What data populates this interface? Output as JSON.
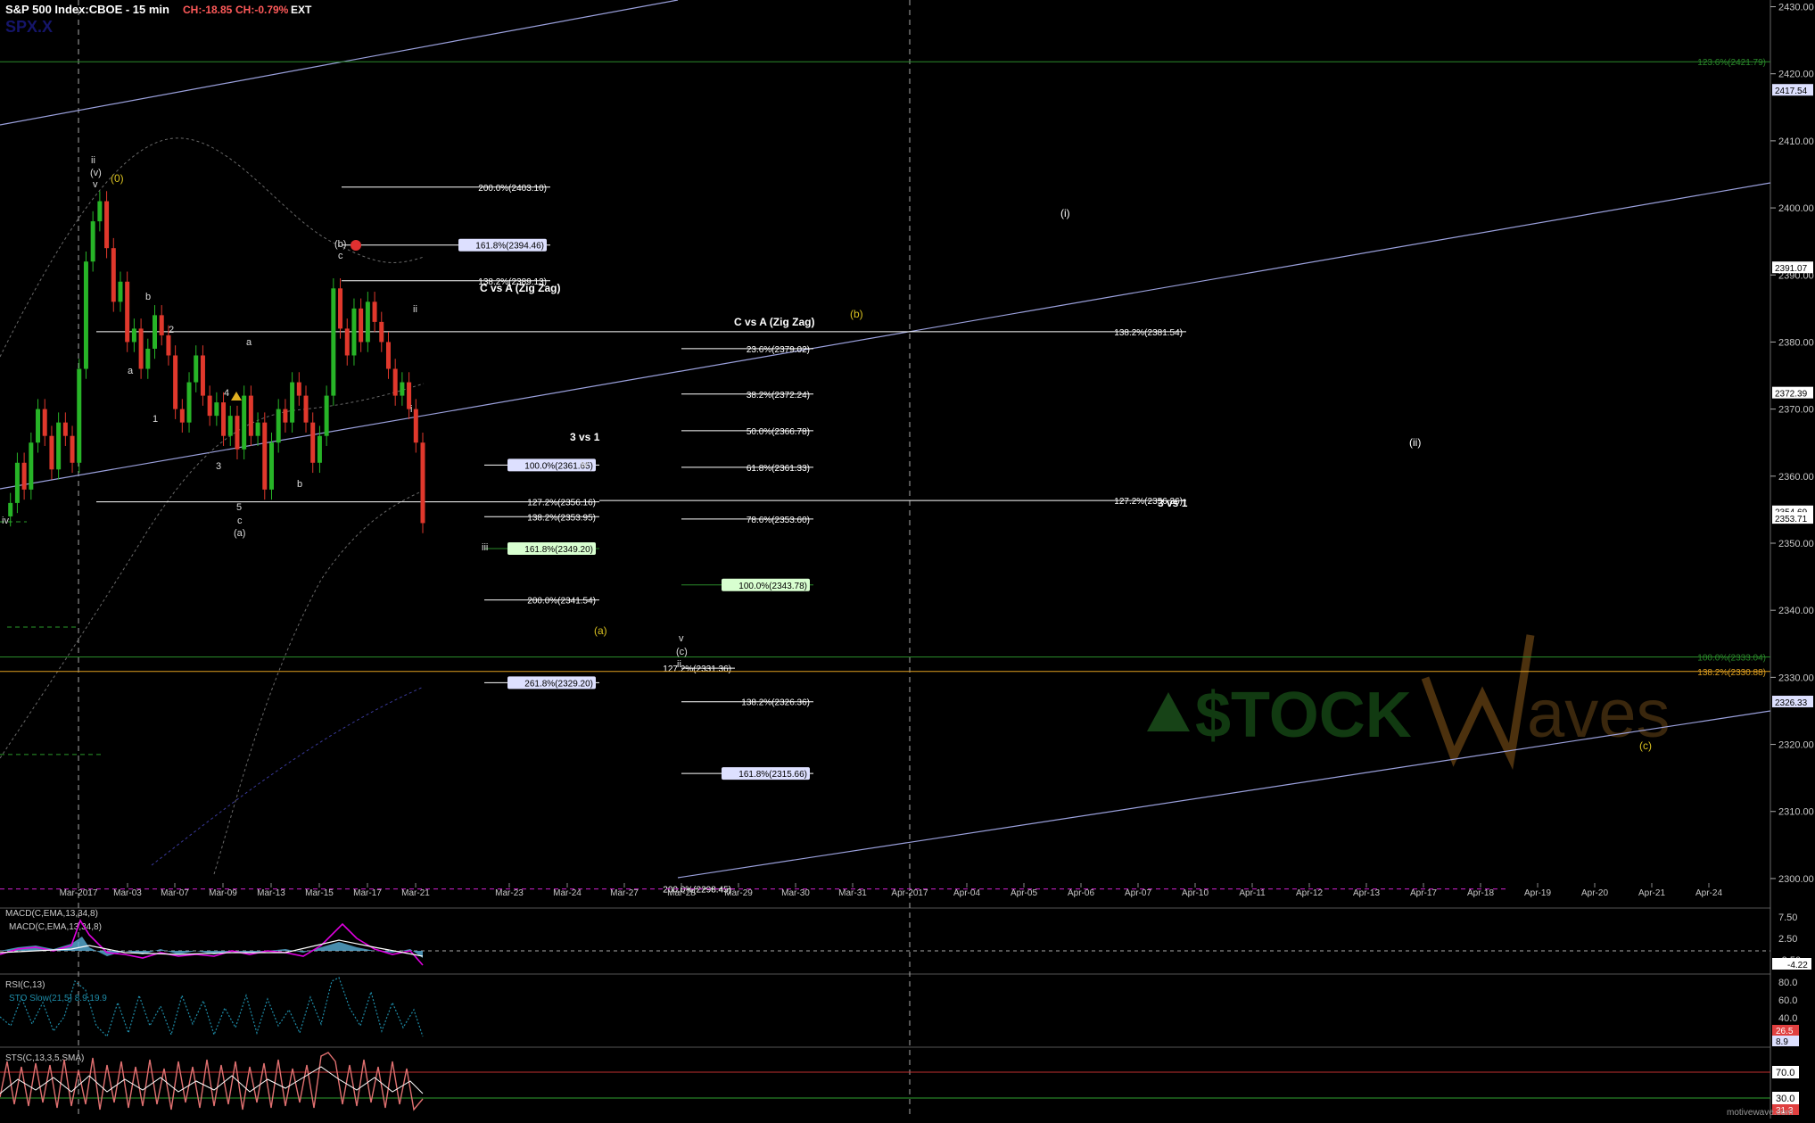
{
  "header": {
    "symbol": "S&P 500 Index:CBOE - 15 min",
    "change_abs": "CH:-18.85",
    "change_pct": "CH:-0.79%",
    "session": "EXT",
    "watermark_symbol": "SPX.X"
  },
  "colors": {
    "background": "#000000",
    "axis_text": "#c8c8c8",
    "up_candle": "#27b427",
    "down_candle": "#e0382c",
    "channel_line": "#9aa0dc",
    "fib_white": "#ffffff",
    "fib_green": "#2a8a2a",
    "fib_orange": "#e0a020",
    "fib_magenta": "#d020d0",
    "label_yellow": "#d8c020",
    "macd_line": "#e000e0",
    "macd_signal": "#ffffff",
    "macd_hist": "#5ab0d8",
    "sto_line": "#1e8ca8",
    "sts_line": "#e07070"
  },
  "chart_data": {
    "type": "line",
    "title": "S&P 500 Index:CBOE - 15 min",
    "price_axis": {
      "min": 2296,
      "max": 2431,
      "ticks": [
        2300,
        2310,
        2320,
        2330,
        2340,
        2350,
        2360,
        2370,
        2380,
        2390,
        2400,
        2410,
        2420,
        2430
      ],
      "tick_labels": [
        "2300.00",
        "2310.00",
        "2320.00",
        "2330.00",
        "2340.00",
        "2350.00",
        "2360.00",
        "2370.00",
        "2380.00",
        "2390.00",
        "2400.00",
        "2410.00",
        "2420.00",
        "2430.00"
      ]
    },
    "x_axis": {
      "labels": [
        "Mar-2017",
        "Mar-03",
        "Mar-07",
        "Mar-09",
        "Mar-13",
        "Mar-15",
        "Mar-17",
        "Mar-21",
        "Mar-23",
        "Mar-24",
        "Mar-27",
        "Mar-28",
        "Mar-29",
        "Mar-30",
        "Mar-31",
        "Apr-2017",
        "Apr-04",
        "Apr-05",
        "Apr-06",
        "Apr-07",
        "Apr-10",
        "Apr-11",
        "Apr-12",
        "Apr-13",
        "Apr-17",
        "Apr-18",
        "Apr-19",
        "Apr-20",
        "Apr-21",
        "Apr-24"
      ]
    },
    "series": [
      {
        "name": "SPX",
        "values": [
          2354,
          2356,
          2362,
          2358,
          2365,
          2370,
          2366,
          2361,
          2368,
          2366,
          2362,
          2376,
          2392,
          2398,
          2401,
          2394,
          2386,
          2389,
          2380,
          2382,
          2376,
          2379,
          2384,
          2381,
          2378,
          2370,
          2368,
          2374,
          2378,
          2372,
          2369,
          2371,
          2366,
          2369,
          2364,
          2372,
          2366,
          2368,
          2358,
          2365,
          2370,
          2368,
          2374,
          2372,
          2368,
          2362,
          2366,
          2372,
          2388,
          2382,
          2378,
          2385,
          2380,
          2386,
          2383,
          2380,
          2376,
          2372,
          2374,
          2370,
          2365,
          2353
        ]
      }
    ],
    "price_tags": [
      {
        "label": "2417.54",
        "value": 2417.54
      },
      {
        "label": "2391.07",
        "value": 2391.07
      },
      {
        "label": "2372.39",
        "value": 2372.39
      },
      {
        "label": "2354.69",
        "value": 2354.69
      },
      {
        "label": "2353.71",
        "value": 2353.71
      },
      {
        "label": "2326.33",
        "value": 2326.33
      }
    ],
    "fib_levels": [
      {
        "label": "200.0%(2403.10)",
        "value": 2403.1,
        "style": "white",
        "box": false
      },
      {
        "label": "161.8%(2394.46)",
        "value": 2394.46,
        "style": "white",
        "box": true
      },
      {
        "label": "138.2%(2389.13)",
        "value": 2389.13,
        "style": "white",
        "box": false
      },
      {
        "label": "23.6%(2379.02)",
        "value": 2379.02,
        "style": "white",
        "box": false
      },
      {
        "label": "38.2%(2372.24)",
        "value": 2372.24,
        "style": "white",
        "box": false
      },
      {
        "label": "50.0%(2366.78)",
        "value": 2366.78,
        "style": "white",
        "box": false
      },
      {
        "label": "100.0%(2361.65)",
        "value": 2361.65,
        "style": "white",
        "box": true
      },
      {
        "label": "61.8%(2361.33)",
        "value": 2361.33,
        "style": "white",
        "box": false
      },
      {
        "label": "127.2%(2356.16)",
        "value": 2356.16,
        "style": "white",
        "box": false
      },
      {
        "label": "138.2%(2353.95)",
        "value": 2353.95,
        "style": "white",
        "box": false
      },
      {
        "label": "78.6%(2353.60)",
        "value": 2353.6,
        "style": "white",
        "box": false
      },
      {
        "label": "161.8%(2349.20)",
        "value": 2349.2,
        "style": "green",
        "box": true
      },
      {
        "label": "100.0%(2343.78)",
        "value": 2343.78,
        "style": "green",
        "box": true
      },
      {
        "label": "200.0%(2341.54)",
        "value": 2341.54,
        "style": "white",
        "box": false
      },
      {
        "label": "127.2%(2331.36)",
        "value": 2331.36,
        "style": "white",
        "box": false
      },
      {
        "label": "261.8%(2329.20)",
        "value": 2329.2,
        "style": "white",
        "box": true
      },
      {
        "label": "138.2%(2326.36)",
        "value": 2326.36,
        "style": "white",
        "box": false
      },
      {
        "label": "161.8%(2315.66)",
        "value": 2315.66,
        "style": "white",
        "box": true
      },
      {
        "label": "200.0%(2298.45)",
        "value": 2298.45,
        "style": "white",
        "box": false
      },
      {
        "label": "138.2%(2381.54)",
        "value": 2381.54,
        "style": "white",
        "box": false
      },
      {
        "label": "127.2%(2356.36)",
        "value": 2356.36,
        "style": "white",
        "box": false
      },
      {
        "label": "123.6%(2421.79)",
        "value": 2421.79,
        "style": "green",
        "box": false
      },
      {
        "label": "100.0%(2333.04)",
        "value": 2333.04,
        "style": "green",
        "box": false
      },
      {
        "label": "138.2%(2330.88)",
        "value": 2330.88,
        "style": "orange",
        "box": false
      }
    ],
    "annotations": [
      {
        "text": "C vs A (Zig Zag)"
      },
      {
        "text": "C vs A (Zig Zag)"
      },
      {
        "text": "3 vs 1"
      },
      {
        "text": "3 vs 1"
      },
      {
        "text": "(i)"
      },
      {
        "text": "(ii)"
      },
      {
        "text": "(b)"
      },
      {
        "text": "(a)"
      },
      {
        "text": "(c)"
      },
      {
        "text": "(0)"
      }
    ],
    "wave_labels": [
      "iv",
      "ii",
      "v",
      "(v)",
      "a",
      "b",
      "2",
      "1",
      "3",
      "4",
      "5",
      "c",
      "(a)",
      "a",
      "b",
      "(b)",
      "c",
      "ii",
      "i",
      "iii",
      "iv",
      "v",
      "(c)",
      "ii"
    ]
  },
  "panels": {
    "macd": {
      "label1": "MACD(C,EMA,13,34,8)",
      "label2": "MACD(C,EMA,13,34,8)",
      "ticks": [
        "7.50",
        "2.50",
        "-2.50"
      ],
      "tag": "-4.22"
    },
    "rsi": {
      "label1": "RSI(C,13)",
      "label2": "STO Slow(21,5) 8.9,19.9",
      "ticks": [
        "80.0",
        "60.0",
        "40.0",
        "20.0"
      ],
      "tag1": "26.5",
      "tag2": "8.9"
    },
    "sts": {
      "label1": "STS(C,13,3,5,SMA)",
      "tag_top": "70.0",
      "tag_mid": "30.0",
      "tag_bot": "31.3"
    }
  },
  "watermark": {
    "brand_stock": "$TOCK",
    "brand_waves": "aves",
    "footer": "motivewave.com"
  }
}
